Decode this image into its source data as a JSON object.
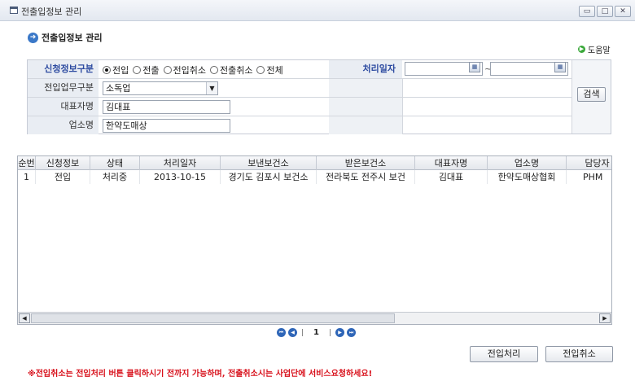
{
  "window": {
    "title": "전출입정보 관리",
    "controls": {
      "minimize": "▭",
      "maximize": "□",
      "close": "✕"
    }
  },
  "header": {
    "title": "전출입정보 관리",
    "help_label": "도움말"
  },
  "form": {
    "request_type_label": "신청정보구분",
    "request_types": [
      "전입",
      "전출",
      "전입취소",
      "전출취소",
      "전체"
    ],
    "request_type_selected": "전입",
    "process_date_label": "처리일자",
    "date_sep": "~",
    "date_from": "",
    "date_to": "",
    "business_type_label": "전입업무구분",
    "business_type_value": "소독업",
    "rep_name_label": "대표자명",
    "rep_name_value": "김대표",
    "shop_name_label": "업소명",
    "shop_name_value": "한약도매상",
    "search_button": "검색"
  },
  "table": {
    "columns": [
      "순번",
      "신청정보",
      "상태",
      "처리일자",
      "보낸보건소",
      "받은보건소",
      "대표자명",
      "업소명",
      "담당자"
    ],
    "rows": [
      [
        "1",
        "전입",
        "처리중",
        "2013-10-15",
        "경기도 김포시 보건소",
        "전라북도 전주시 보건",
        "김대표",
        "한약도매상협회",
        "PHM"
      ]
    ]
  },
  "pager": {
    "current_page": "1",
    "sep": "|"
  },
  "actions": {
    "approve_transfer_in": "전입처리",
    "cancel_transfer_in": "전입취소"
  },
  "notice": "※전입취소는 전입처리 버튼 클릭하시기 전까지 가능하며, 전출취소시는 사업단에 서비스요청하세요!",
  "colors": {
    "notice": "#d8101b",
    "accent": "#2c4aa0",
    "label_bg": "#e9edf3"
  }
}
